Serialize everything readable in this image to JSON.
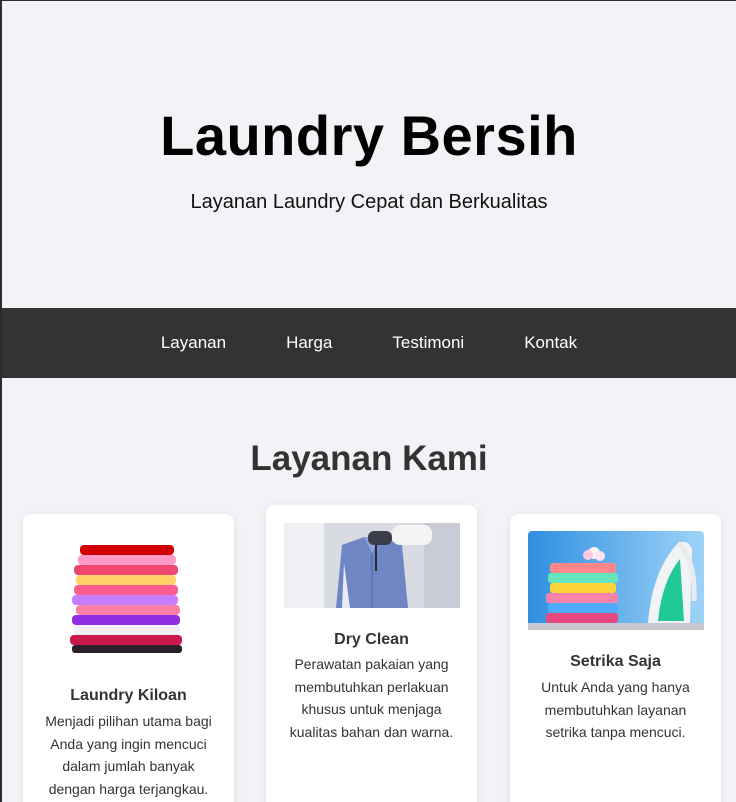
{
  "header": {
    "title": "Laundry Bersih",
    "subtitle": "Layanan Laundry Cepat dan Berkualitas"
  },
  "nav": {
    "items": [
      {
        "label": "Layanan"
      },
      {
        "label": "Harga"
      },
      {
        "label": "Testimoni"
      },
      {
        "label": "Kontak"
      }
    ]
  },
  "services": {
    "title": "Layanan Kami",
    "cards": [
      {
        "title": "Laundry Kiloan",
        "description": "Menjadi pilihan utama bagi Anda yang ingin mencuci dalam jumlah banyak dengan harga terjangkau.",
        "image_icon": "folded-clothes-stack-icon"
      },
      {
        "title": "Dry Clean",
        "description": "Perawatan pakaian yang membutuhkan perlakuan khusus untuk menjaga kualitas bahan dan warna.",
        "image_icon": "steamer-shirt-icon"
      },
      {
        "title": "Setrika Saja",
        "description": "Untuk Anda yang hanya membutuhkan layanan setrika tanpa mencuci.",
        "image_icon": "iron-clothes-icon"
      }
    ]
  },
  "colors": {
    "background": "#f3f2f7",
    "nav_background": "#333333",
    "card_background": "#ffffff",
    "text_dark": "#333333"
  }
}
